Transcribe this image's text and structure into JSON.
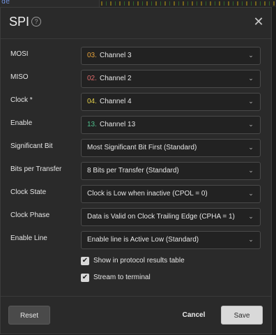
{
  "background": {
    "tab_text": "de"
  },
  "dialog": {
    "title": "SPI",
    "help_glyph": "?",
    "close_glyph": "✕"
  },
  "fields": [
    {
      "label": "MOSI",
      "num": "03.",
      "num_color": "#e7a23a",
      "value": "Channel 3"
    },
    {
      "label": "MISO",
      "num": "02.",
      "num_color": "#e06b6b",
      "value": "Channel 2"
    },
    {
      "label": "Clock *",
      "num": "04.",
      "num_color": "#e3d04a",
      "value": "Channel 4"
    },
    {
      "label": "Enable",
      "num": "13.",
      "num_color": "#4fc08d",
      "value": "Channel 13"
    },
    {
      "label": "Significant Bit",
      "value": "Most Significant Bit First (Standard)"
    },
    {
      "label": "Bits per Transfer",
      "value": "8 Bits per Transfer (Standard)"
    },
    {
      "label": "Clock State",
      "value": "Clock is Low when inactive (CPOL = 0)"
    },
    {
      "label": "Clock Phase",
      "value": "Data is Valid on Clock Trailing Edge (CPHA = 1)"
    },
    {
      "label": "Enable Line",
      "value": "Enable line is Active Low (Standard)"
    }
  ],
  "checkboxes": [
    {
      "label": "Show in protocol results table",
      "checked": true
    },
    {
      "label": "Stream to terminal",
      "checked": true
    }
  ],
  "footer": {
    "reset": "Reset",
    "cancel": "Cancel",
    "save": "Save"
  },
  "icons": {
    "chevron": "chevron-down-icon",
    "check": "checkmark-icon"
  }
}
